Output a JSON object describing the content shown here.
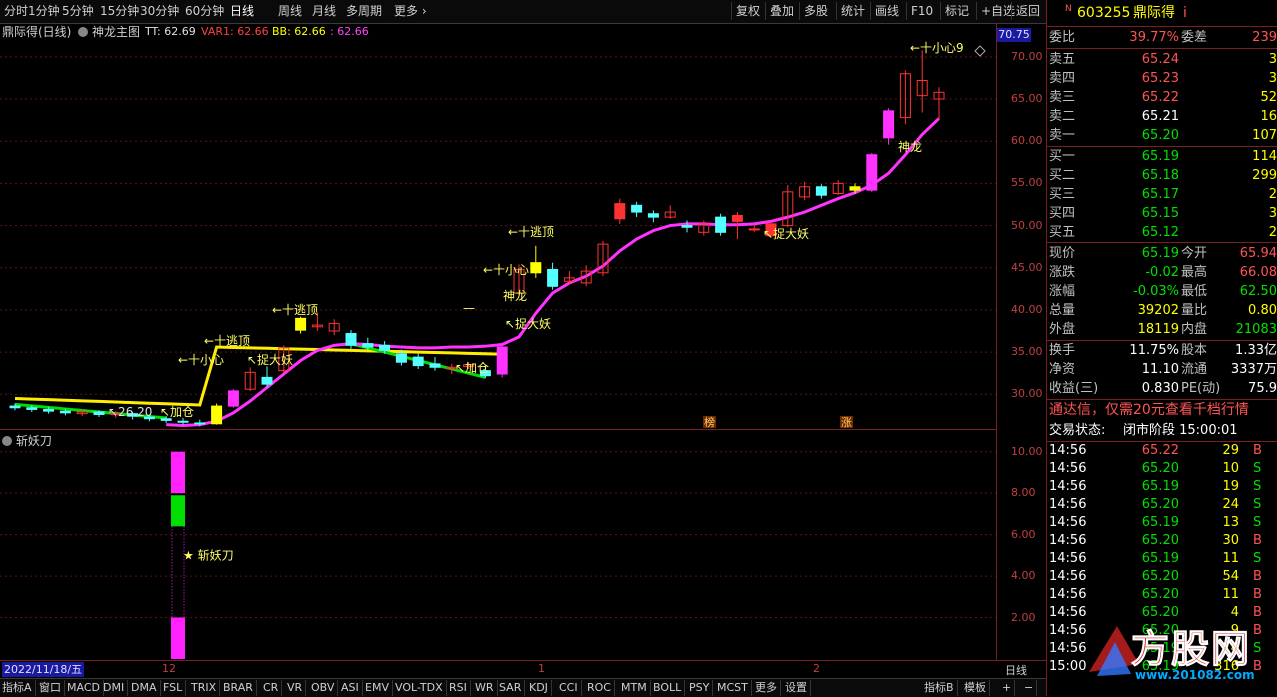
{
  "toolbar": {
    "left_items": [
      "分时",
      "1分钟",
      "5分钟",
      "15分钟",
      "30分钟",
      "60分钟",
      "日线",
      "周线",
      "月线",
      "多周期",
      "更多"
    ],
    "active": "日线",
    "right_items": [
      "复权",
      "叠加",
      "多股",
      "统计",
      "画线",
      "F10",
      "标记",
      "+自选",
      "返回"
    ]
  },
  "info": {
    "stock": "鼎际得(日线)",
    "indicator": "神龙主图",
    "tt": "TT: 62.69",
    "var1": "VAR1: 62.66",
    "bb": "BB: 62.66",
    "last": ": 62.66"
  },
  "main_axis": {
    "ticks": [
      "70.00",
      "65.00",
      "60.00",
      "55.00",
      "50.00",
      "45.00",
      "40.00",
      "35.00",
      "30.00"
    ],
    "current_price": "70.75"
  },
  "sub_axis": {
    "ticks": [
      "10.00",
      "8.00",
      "6.00",
      "4.00",
      "2.00"
    ]
  },
  "sub": {
    "title": "斩妖刀",
    "signal": "★ 斩妖刀"
  },
  "annotations": {
    "low_price": "26.20",
    "jiacang": "加仓",
    "xiaoxin": "小心",
    "taoding": "逃顶",
    "zhuodayao": "捉大妖",
    "shenlong": "神龙",
    "xiaoxin9": "小心9",
    "bang": "榜",
    "zhang": "涨"
  },
  "datebar": {
    "date": "2022/11/18/五",
    "months": [
      "12",
      "1",
      "2"
    ],
    "period": "日线"
  },
  "bottombar": {
    "items": [
      "指标A",
      "窗口",
      "MACD",
      "DMI",
      "DMA",
      "FSL",
      "TRIX",
      "BRAR",
      "CR",
      "VR",
      "OBV",
      "ASI",
      "EMV",
      "VOL-TDX",
      "RSI",
      "WR",
      "SAR",
      "KDJ",
      "CCI",
      "ROC",
      "MTM",
      "BOLL",
      "PSY",
      "MCST",
      "更多",
      "设置"
    ],
    "right_items": [
      "指标B",
      "模板",
      "+",
      "−"
    ]
  },
  "panel": {
    "code": "603255",
    "name": "鼎际得",
    "weibi_label": "委比",
    "weibi": "39.77%",
    "weicha_label": "委差",
    "weicha": "239",
    "asks": [
      {
        "label": "卖五",
        "price": "65.24",
        "vol": "3"
      },
      {
        "label": "卖四",
        "price": "65.23",
        "vol": "3"
      },
      {
        "label": "卖三",
        "price": "65.22",
        "vol": "52"
      },
      {
        "label": "卖二",
        "price": "65.21",
        "vol": "16"
      },
      {
        "label": "卖一",
        "price": "65.20",
        "vol": "107"
      }
    ],
    "bids": [
      {
        "label": "买一",
        "price": "65.19",
        "vol": "114"
      },
      {
        "label": "买二",
        "price": "65.18",
        "vol": "299"
      },
      {
        "label": "买三",
        "price": "65.17",
        "vol": "2"
      },
      {
        "label": "买四",
        "price": "65.15",
        "vol": "3"
      },
      {
        "label": "买五",
        "price": "65.12",
        "vol": "2"
      }
    ],
    "stats": [
      {
        "l1": "现价",
        "v1": "65.19",
        "l2": "今开",
        "v2": "65.94"
      },
      {
        "l1": "涨跌",
        "v1": "-0.02",
        "l2": "最高",
        "v2": "66.08"
      },
      {
        "l1": "涨幅",
        "v1": "-0.03%",
        "l2": "最低",
        "v2": "62.50"
      },
      {
        "l1": "总量",
        "v1": "39202",
        "l2": "量比",
        "v2": "0.80"
      },
      {
        "l1": "外盘",
        "v1": "18119",
        "l2": "内盘",
        "v2": "21083"
      }
    ],
    "stats2": [
      {
        "l1": "换手",
        "v1": "11.75%",
        "l2": "股本",
        "v2": "1.33亿"
      },
      {
        "l1": "净资",
        "v1": "11.10",
        "l2": "流通",
        "v2": "3337万"
      },
      {
        "l1": "收益(三)",
        "v1": "0.830",
        "l2": "PE(动)",
        "v2": "75.9"
      }
    ],
    "promo": "通达信，仅需20元查看千档行情",
    "status_label": "交易状态:",
    "status": "闭市阶段 15:00:01",
    "ticks": [
      {
        "t": "14:56",
        "p": "65.22",
        "v": "29",
        "s": "B"
      },
      {
        "t": "14:56",
        "p": "65.20",
        "v": "10",
        "s": "S"
      },
      {
        "t": "14:56",
        "p": "65.19",
        "v": "19",
        "s": "S"
      },
      {
        "t": "14:56",
        "p": "65.20",
        "v": "24",
        "s": "S"
      },
      {
        "t": "14:56",
        "p": "65.19",
        "v": "13",
        "s": "S"
      },
      {
        "t": "14:56",
        "p": "65.20",
        "v": "30",
        "s": "B"
      },
      {
        "t": "14:56",
        "p": "65.19",
        "v": "11",
        "s": "S"
      },
      {
        "t": "14:56",
        "p": "65.20",
        "v": "54",
        "s": "B"
      },
      {
        "t": "14:56",
        "p": "65.20",
        "v": "11",
        "s": "B"
      },
      {
        "t": "14:56",
        "p": "65.20",
        "v": "4",
        "s": "B"
      },
      {
        "t": "14:56",
        "p": "65.20",
        "v": "9",
        "s": "B"
      },
      {
        "t": "14:56",
        "p": "65.19",
        "v": "4",
        "s": "S"
      },
      {
        "t": "15:00",
        "p": "65.19",
        "v": "316",
        "s": "B"
      }
    ],
    "watermark": "方股网",
    "watermark_url": "www.201082.com"
  },
  "chart_data": {
    "type": "candlestick",
    "ylim": [
      26,
      72
    ],
    "candles": [
      [
        28.6,
        28.4,
        28.9,
        28.1
      ],
      [
        28.4,
        28.2,
        28.7,
        27.9
      ],
      [
        28.2,
        28.0,
        28.5,
        27.7
      ],
      [
        28.0,
        27.8,
        28.3,
        27.5
      ],
      [
        27.7,
        27.9,
        28.2,
        27.4
      ],
      [
        27.9,
        27.6,
        28.1,
        27.3
      ],
      [
        27.6,
        27.7,
        28.0,
        27.2
      ],
      [
        27.7,
        27.4,
        27.9,
        27.0
      ],
      [
        27.3,
        27.1,
        27.6,
        26.8
      ],
      [
        27.1,
        26.9,
        27.4,
        26.6
      ],
      [
        26.8,
        26.7,
        27.2,
        26.4
      ],
      [
        26.6,
        26.5,
        27.0,
        26.2
      ],
      [
        26.5,
        28.6,
        28.9,
        26.4
      ],
      [
        28.6,
        30.4,
        30.6,
        28.4
      ],
      [
        30.6,
        32.6,
        33.2,
        30.4
      ],
      [
        32.0,
        31.2,
        33.3,
        30.8
      ],
      [
        32.8,
        35.5,
        35.8,
        32.6
      ],
      [
        37.6,
        39.0,
        39.2,
        37.2
      ],
      [
        38.0,
        38.2,
        39.7,
        37.5
      ],
      [
        37.5,
        38.4,
        38.9,
        37.0
      ],
      [
        37.2,
        35.8,
        37.6,
        35.4
      ],
      [
        36.0,
        35.6,
        36.7,
        35.2
      ],
      [
        35.8,
        35.2,
        36.3,
        34.8
      ],
      [
        34.8,
        33.8,
        35.3,
        33.4
      ],
      [
        34.4,
        33.4,
        34.8,
        33.0
      ],
      [
        33.6,
        33.2,
        34.4,
        32.8
      ],
      [
        33.0,
        33.2,
        33.6,
        32.4
      ],
      [
        33.3,
        33.5,
        33.8,
        33.0
      ],
      [
        32.8,
        32.2,
        33.4,
        31.9
      ],
      [
        32.4,
        35.6,
        35.9,
        32.0
      ],
      [
        42.0,
        44.8,
        45.4,
        41.8
      ],
      [
        45.6,
        44.4,
        47.6,
        43.8
      ],
      [
        44.8,
        42.8,
        45.6,
        42.4
      ],
      [
        43.4,
        43.8,
        44.6,
        43.0
      ],
      [
        43.2,
        44.6,
        45.3,
        42.8
      ],
      [
        44.4,
        47.8,
        48.2,
        44.0
      ],
      [
        50.8,
        52.6,
        53.2,
        50.2
      ],
      [
        52.4,
        51.6,
        52.8,
        51.0
      ],
      [
        51.4,
        51.0,
        51.8,
        50.4
      ],
      [
        51.0,
        51.6,
        52.4,
        50.8
      ],
      [
        50.0,
        49.8,
        50.6,
        49.2
      ],
      [
        49.2,
        50.2,
        50.6,
        48.8
      ],
      [
        51.0,
        49.2,
        51.4,
        48.8
      ],
      [
        50.5,
        51.2,
        51.6,
        48.4
      ],
      [
        49.6,
        49.6,
        50.0,
        49.2
      ],
      [
        48.8,
        50.2,
        50.4,
        48.6
      ],
      [
        50.0,
        54.0,
        54.8,
        49.8
      ],
      [
        53.4,
        54.6,
        55.2,
        53.0
      ],
      [
        54.6,
        53.6,
        54.9,
        53.2
      ],
      [
        53.8,
        55.0,
        55.4,
        53.6
      ],
      [
        54.2,
        54.6,
        55.0,
        53.8
      ],
      [
        54.2,
        58.4,
        58.6,
        54.0
      ],
      [
        60.4,
        63.6,
        63.9,
        59.6
      ],
      [
        62.8,
        68.0,
        68.4,
        62.0
      ],
      [
        65.4,
        67.2,
        70.8,
        63.4
      ],
      [
        65.0,
        65.8,
        66.4,
        62.5
      ]
    ]
  }
}
